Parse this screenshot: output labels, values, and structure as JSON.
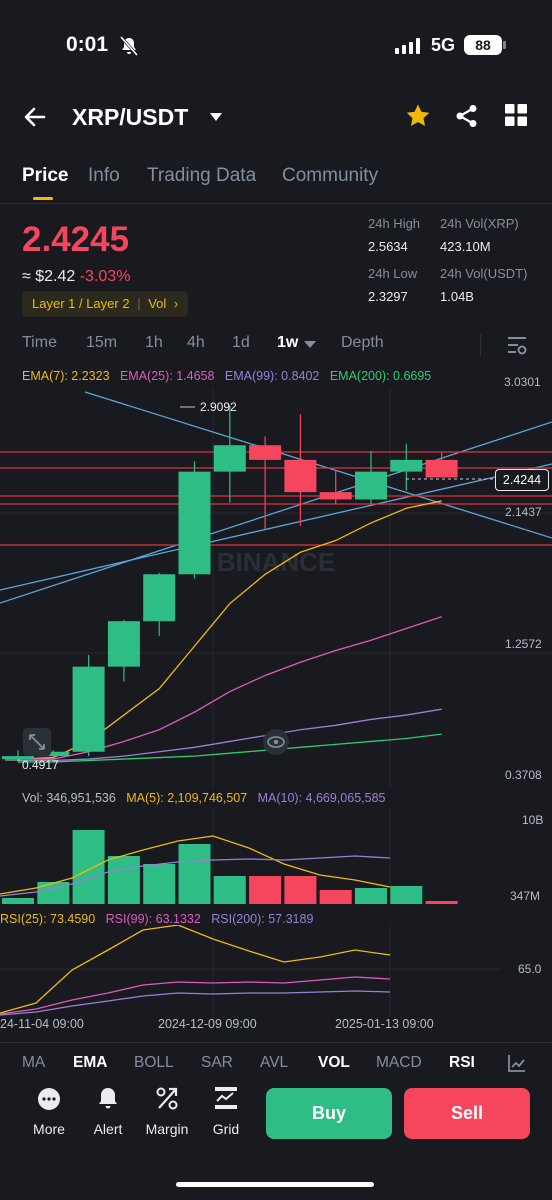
{
  "status_bar": {
    "time": "0:01",
    "network": "5G",
    "battery": "88"
  },
  "header": {
    "pair": "XRP/USDT",
    "icons": [
      "back-arrow-icon",
      "caret-down-icon",
      "star-icon",
      "share-icon",
      "grid-icon"
    ],
    "star_color": "#f0b90b"
  },
  "tabs": [
    "Price",
    "Info",
    "Trading Data",
    "Community"
  ],
  "active_tab": "Price",
  "ticker": {
    "last_price": "2.4245",
    "approx_usd": "≈ $2.42",
    "change": "-3.03%",
    "tags": "Layer 1 / Layer 2",
    "vol_tag": "Vol",
    "high_label": "24h High",
    "high": "2.5634",
    "vol_xrp_label": "24h Vol(XRP)",
    "vol_xrp": "423.10M",
    "low_label": "24h Low",
    "low": "2.3297",
    "vol_usdt_label": "24h Vol(USDT)",
    "vol_usdt": "1.04B"
  },
  "intervals": [
    "Time",
    "15m",
    "1h",
    "4h",
    "1d",
    "1w",
    "Depth"
  ],
  "active_interval": "1w",
  "ema_legend": {
    "ema7": "EMA(7): 2.2323",
    "ema25": "EMA(25): 1.4658",
    "ema99": "EMA(99): 0.8402",
    "ema200": "EMA(200): 0.6695"
  },
  "price_axis": {
    "top": "3.0301",
    "current": "2.4244",
    "mid1": "2.1437",
    "mid2": "1.2572",
    "bottom": "0.3708",
    "high_marker": "2.9092",
    "low_marker": "0.4917"
  },
  "watermark": "BINANCE",
  "candles": [
    {
      "o": 0.5,
      "h": 0.56,
      "l": 0.48,
      "c": 0.52
    },
    {
      "o": 0.52,
      "h": 0.56,
      "l": 0.49,
      "c": 0.55
    },
    {
      "o": 0.55,
      "h": 1.21,
      "l": 0.52,
      "c": 1.13
    },
    {
      "o": 1.13,
      "h": 1.45,
      "l": 1.03,
      "c": 1.44
    },
    {
      "o": 1.44,
      "h": 1.77,
      "l": 1.34,
      "c": 1.76
    },
    {
      "o": 1.76,
      "h": 2.53,
      "l": 1.73,
      "c": 2.46
    },
    {
      "o": 2.46,
      "h": 2.91,
      "l": 2.25,
      "c": 2.64
    },
    {
      "o": 2.64,
      "h": 2.7,
      "l": 2.07,
      "c": 2.54
    },
    {
      "o": 2.54,
      "h": 2.85,
      "l": 2.09,
      "c": 2.32
    },
    {
      "o": 2.32,
      "h": 2.47,
      "l": 2.24,
      "c": 2.27
    },
    {
      "o": 2.27,
      "h": 2.6,
      "l": 2.24,
      "c": 2.46
    },
    {
      "o": 2.46,
      "h": 2.65,
      "l": 2.33,
      "c": 2.54
    },
    {
      "o": 2.54,
      "h": 2.59,
      "l": 2.42,
      "c": 2.42
    }
  ],
  "volume_legend": {
    "vol": "Vol: 346,951,536",
    "ma5": "MA(5): 2,109,746,507",
    "ma10": "MA(10): 4,669,065,585",
    "axis_top": "10B",
    "axis_bottom": "347M"
  },
  "rsi_legend": {
    "rsi25": "RSI(25): 73.4590",
    "rsi99": "RSI(99): 63.1332",
    "rsi200": "RSI(200): 57.3189",
    "axis": "65.0"
  },
  "dates": [
    "24-11-04 09:00",
    "2024-12-09 09:00",
    "2025-01-13 09:00"
  ],
  "indicators": [
    "MA",
    "EMA",
    "BOLL",
    "SAR",
    "AVL",
    "VOL",
    "MACD",
    "RSI"
  ],
  "active_indicators": [
    "EMA",
    "VOL",
    "RSI"
  ],
  "actions": [
    "More",
    "Alert",
    "Margin",
    "Grid"
  ],
  "buy_label": "Buy",
  "sell_label": "Sell",
  "colors": {
    "up": "#2ebd85",
    "down": "#f6465d",
    "accent": "#f0b90b",
    "bg": "#181a20"
  }
}
